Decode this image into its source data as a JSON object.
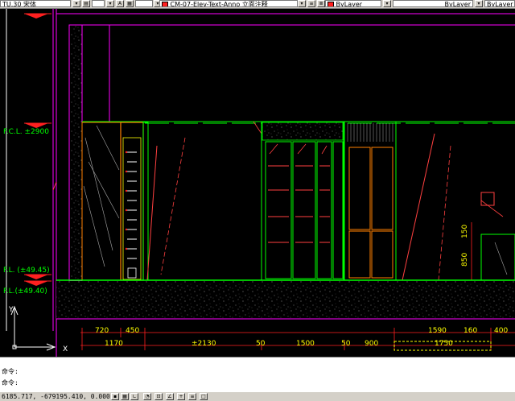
{
  "toolbar": {
    "text_style": "TU.30 宋体",
    "dim_style": "CM-07-Elev-Text-Anno 立面注释",
    "color": "ByLayer",
    "linetype": "ByLayer",
    "lineweight": "ByLayer"
  },
  "levels": {
    "fcl": "F.C.L. ±2900",
    "fl1": "F.L. (±49.45)",
    "fl2": "F.L.(±49.40)"
  },
  "dims": {
    "d720": "720",
    "d450": "450",
    "d1170": "1170",
    "d2130": "±2130",
    "d50a": "50",
    "d1500": "1500",
    "d50b": "50",
    "d900": "900",
    "d1590": "1590",
    "d160": "160",
    "d400": "400",
    "d1750": "1750",
    "v150": "150",
    "v850": "850"
  },
  "ucs": {
    "y": "Y",
    "x": "X"
  },
  "command": {
    "line1": "命令:",
    "line2": "命令:",
    "prompt": "命令:"
  },
  "status": {
    "coords": "6185.717, -679195.410, 0.000"
  },
  "colors": {
    "background": "#000000",
    "magenta": "#ff00ff",
    "green": "#00ff00",
    "orange": "#ff8000",
    "red": "#ff2020",
    "white": "#ffffff",
    "yellow": "#ffff00"
  }
}
